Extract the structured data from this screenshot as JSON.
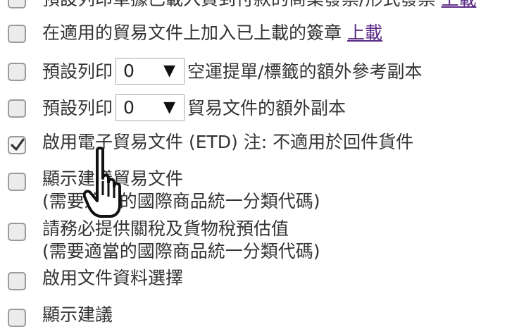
{
  "options": {
    "row0": {
      "text": "預設列印單據已載入貨到付款的商業發票/形式發票",
      "link": "上載"
    },
    "row1": {
      "text": "在適用的貿易文件上加入已上載的簽章",
      "link": "上載"
    },
    "row2": {
      "prefix": "預設列印",
      "select_value": "0",
      "suffix": "空運提單/標籤的額外參考副本"
    },
    "row3": {
      "prefix": "預設列印",
      "select_value": "0",
      "suffix": "貿易文件的額外副本"
    },
    "row4": {
      "text": "啟用電子貿易文件 (ETD) 注: 不適用於回件貨件"
    },
    "row5": {
      "line1": "顯示建議貿易文件",
      "line2": "(需要適當的國際商品統一分類代碼)"
    },
    "row6": {
      "line1": "請務必提供關稅及貨物稅預估值",
      "line2": "(需要適當的國際商品統一分類代碼)"
    },
    "row7": {
      "text": "啟用文件資料選擇"
    },
    "row8": {
      "text": "顯示建議"
    }
  },
  "icons": {
    "select_arrow": "▼",
    "cursor": "hand-pointer-icon",
    "check": "checkmark-icon"
  },
  "colors": {
    "link": "#5b2a86",
    "text": "#333333",
    "checkbox_border": "#9a9a9a"
  }
}
